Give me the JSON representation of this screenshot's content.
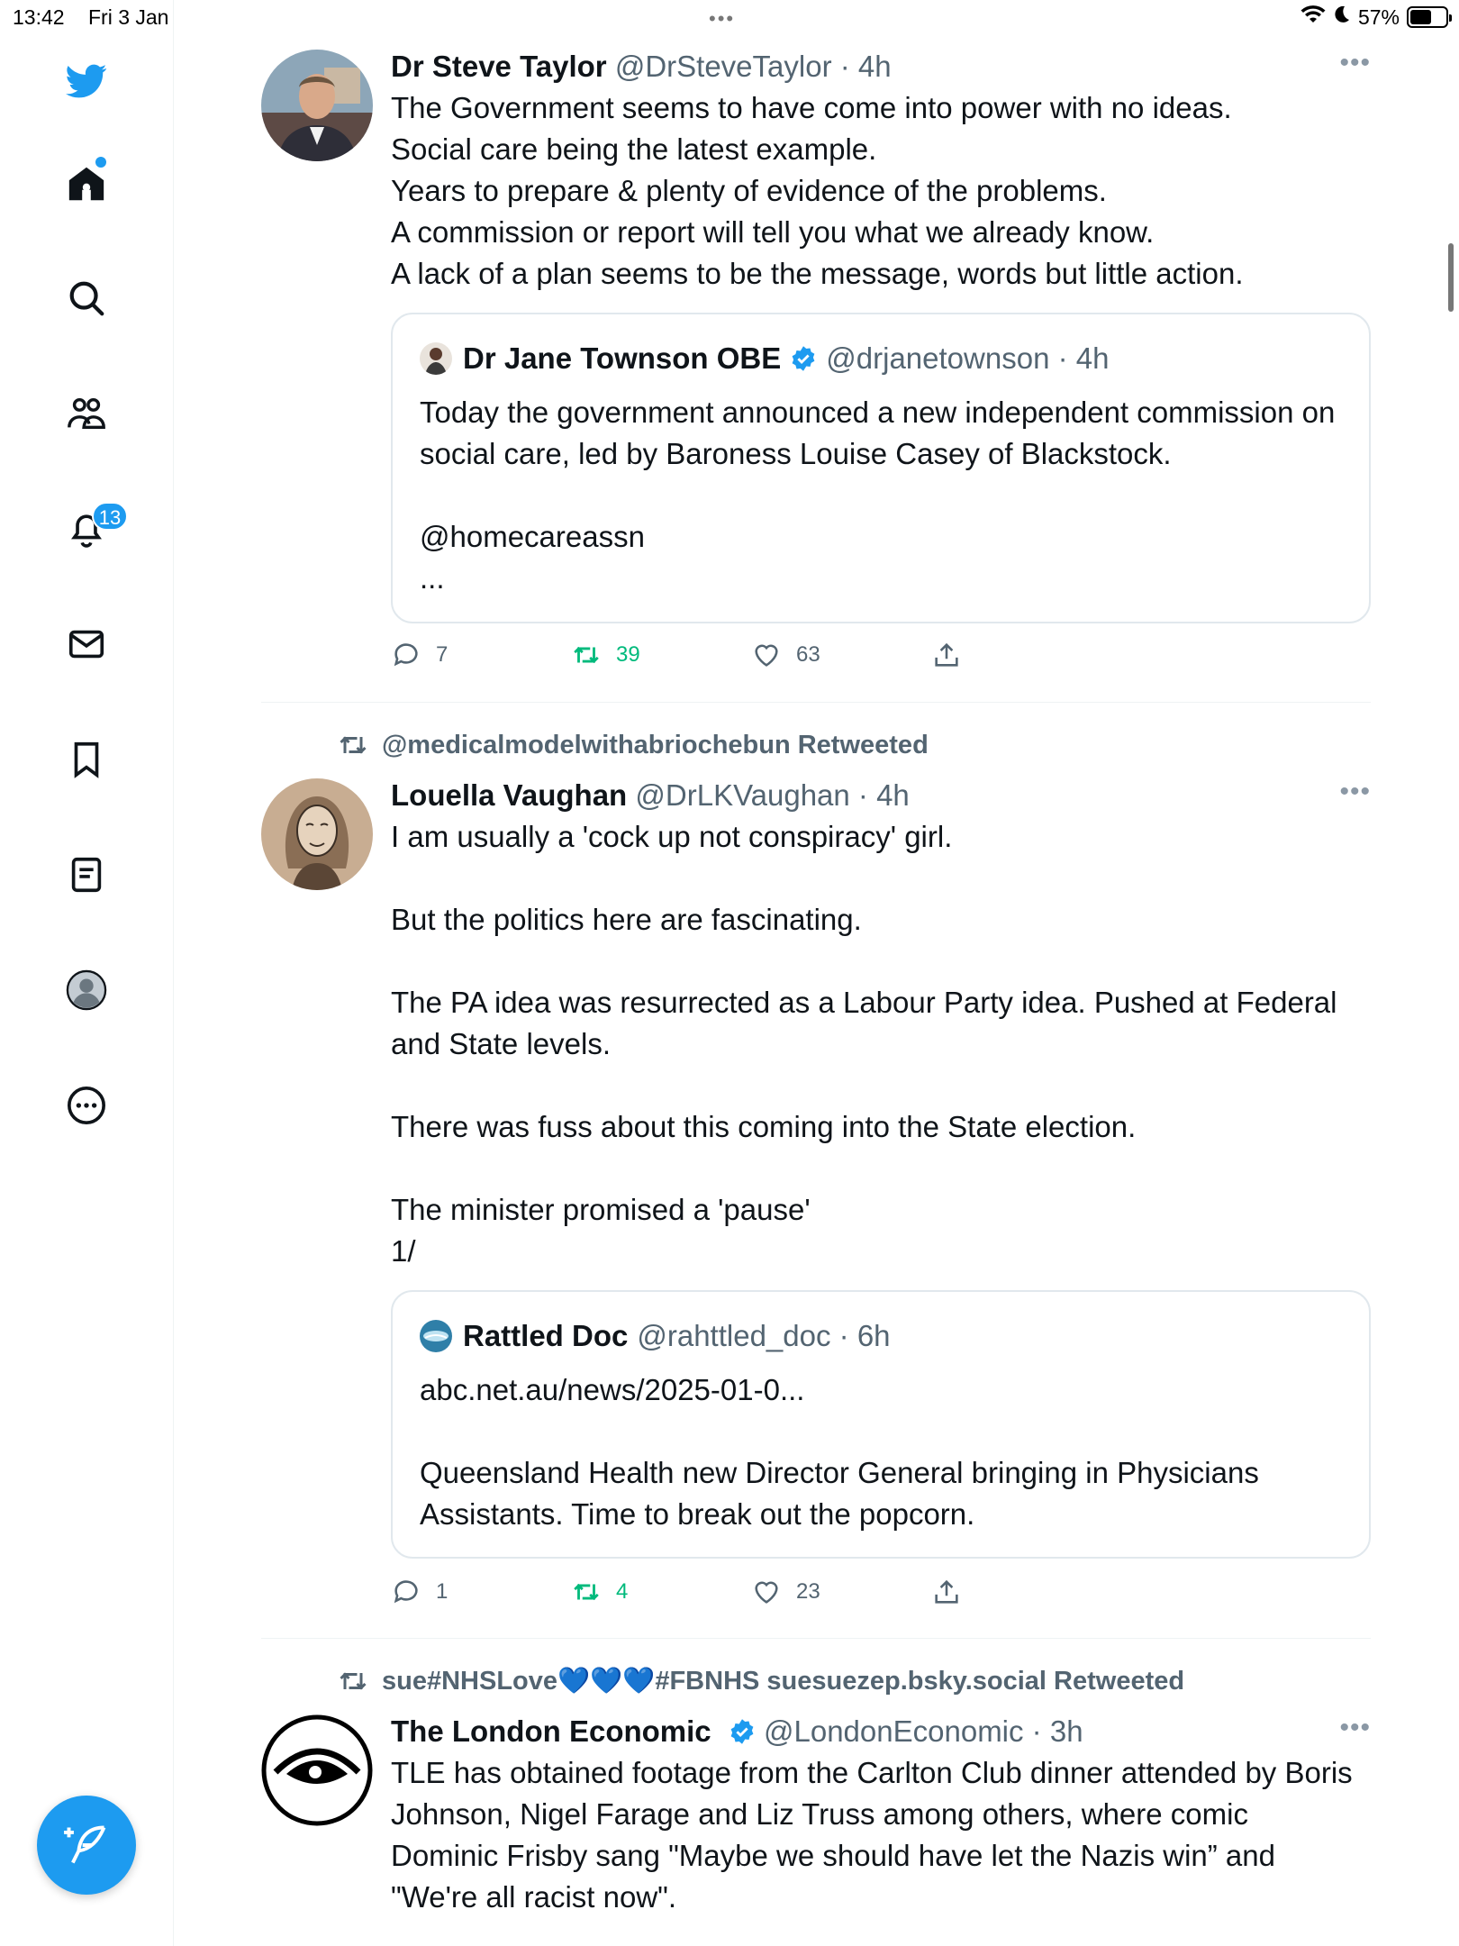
{
  "status_bar": {
    "time": "13:42",
    "date": "Fri 3 Jan",
    "battery": "57%",
    "dots": "•••"
  },
  "sidebar": {
    "notifications_badge": "13",
    "items": [
      "twitter-logo",
      "home",
      "search",
      "communities",
      "notifications",
      "messages",
      "bookmarks",
      "lists",
      "profile",
      "more"
    ]
  },
  "tweets": [
    {
      "name": "Dr Steve Taylor",
      "handle": "@DrSteveTaylor · 4h",
      "text": "The Government seems to have come into power with no ideas.\nSocial care being the latest example.\nYears to prepare & plenty of evidence of the problems.\nA commission or report will tell you what we already know.\nA lack of a plan seems to be the message, words but little action.",
      "quote": {
        "name": "Dr Jane Townson OBE",
        "handle": "@drjanetownson · 4h",
        "text": "Today the government announced a new independent commission on social care, led by Baroness Louise Casey of Blackstock.\n\n@homecareassn\n..."
      },
      "replies": "7",
      "retweets": "39",
      "likes": "63"
    },
    {
      "retweeted_by": "@medicalmodelwithabriochebun Retweeted",
      "name": "Louella Vaughan",
      "handle": "@DrLKVaughan · 4h",
      "text": "I am usually a 'cock up not conspiracy' girl.\n\nBut the politics here are fascinating.\n\nThe PA idea was resurrected as a Labour Party idea. Pushed at Federal and State levels.\n\nThere was fuss about this coming into the State election.\n\nThe minister promised a 'pause'\n1/",
      "quote": {
        "name": "Rattled Doc",
        "handle": "@rahttled_doc · 6h",
        "text": "abc.net.au/news/2025-01-0...\n\nQueensland Health new Director General bringing in Physicians Assistants. Time to break out the popcorn."
      },
      "replies": "1",
      "retweets": "4",
      "likes": "23"
    },
    {
      "retweeted_by": "sue#NHSLove💙💙💙#FBNHS suesuezep.bsky.social Retweeted",
      "name": "The London Economic",
      "handle": "@LondonEconomic · 3h",
      "text": "TLE has obtained footage from the Carlton Club dinner attended by Boris Johnson, Nigel Farage and Liz Truss among others, where comic Dominic Frisby sang \"Maybe we should have let the Nazis win” and \"We're all racist now\"."
    }
  ],
  "colors": {
    "accent": "#1d9bf0",
    "retweet": "#00ba7c",
    "muted": "#536471"
  }
}
